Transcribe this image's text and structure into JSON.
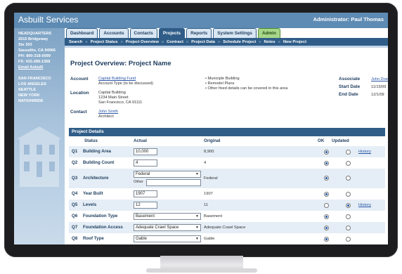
{
  "app": {
    "title": "Asbuilt Services",
    "admin": "Administrator: Paul Thomas"
  },
  "sidebar": {
    "address": [
      "HEADQUARTERS",
      "2015 Bridgeway",
      "Ste 303",
      "Sausalito, CA 94966",
      "PH: 800-318-0099",
      "FX: 415-289-1358"
    ],
    "email": "Email Asbuilt",
    "cities": [
      "SAN FRANCISCO",
      "LOS ANGELES",
      "SEATTLE",
      "NEW YORK",
      "NATIONWIDE"
    ]
  },
  "tabs": [
    {
      "label": "Dashboard"
    },
    {
      "label": "Accounts"
    },
    {
      "label": "Contacts"
    },
    {
      "label": "Projects"
    },
    {
      "label": "Reports"
    },
    {
      "label": "System Settings"
    },
    {
      "label": "Admin"
    }
  ],
  "subnav": [
    "Search",
    "Project Status",
    "Project Overview",
    "Contract",
    "Project Data",
    "Schedule Project",
    "Notes",
    "New Project"
  ],
  "overview": {
    "title": "Project Overview:",
    "subtitle": "Project Name",
    "account_label": "Account",
    "account_link": "Capital Building Fund",
    "account_type": "Account Type (to be discussed)",
    "location_label": "Location",
    "location_lines": [
      "Capital Building",
      "1234 Main Street",
      "San Francisco, CA 91111"
    ],
    "contact_label": "Contact",
    "contact_name": "John Smith",
    "contact_role": "Architect",
    "bullets": [
      "• Municiple Building",
      "• Remodel Plans",
      "• Other fixed details can be covered in this area"
    ],
    "associate_label": "Associate",
    "associate_value": "John Doe",
    "start_label": "Start Date",
    "start_value": "11/15/09",
    "end_label": "End Date",
    "end_value": "12/1/09"
  },
  "details": {
    "heading": "Project Details",
    "columns": {
      "status": "Status",
      "actual": "Actual",
      "original": "Original",
      "ok": "OK",
      "updated": "Updated"
    },
    "other_label": "Other",
    "history_label": "History",
    "rows": [
      {
        "q": "Q1",
        "label": "Building Area",
        "actual": "10,000",
        "original": "8,900",
        "ok": true,
        "history": true
      },
      {
        "q": "Q2",
        "label": "Building Count",
        "actual": "4",
        "original": "4",
        "ok": true,
        "history": false
      },
      {
        "q": "Q3",
        "label": "Architecture",
        "actual": "Federal",
        "original": "Federal",
        "ok": true,
        "history": false
      },
      {
        "q": "Q4",
        "label": "Year Built",
        "actual": "1907",
        "original": "1907",
        "ok": true,
        "history": false
      },
      {
        "q": "Q5",
        "label": "Levels",
        "actual": "12",
        "original": "11",
        "ok": false,
        "history": true
      },
      {
        "q": "Q6",
        "label": "Foundation Type",
        "actual": "Basement",
        "original": "Basement",
        "ok": true,
        "history": false
      },
      {
        "q": "Q7",
        "label": "Foundation Access",
        "actual": "Adequate Crawl Space",
        "original": "Adequate Crawl Space",
        "ok": true,
        "history": false
      },
      {
        "q": "Q8",
        "label": "Roof Type",
        "actual": "Gable",
        "original": "Gable",
        "ok": true,
        "history": false
      }
    ]
  }
}
